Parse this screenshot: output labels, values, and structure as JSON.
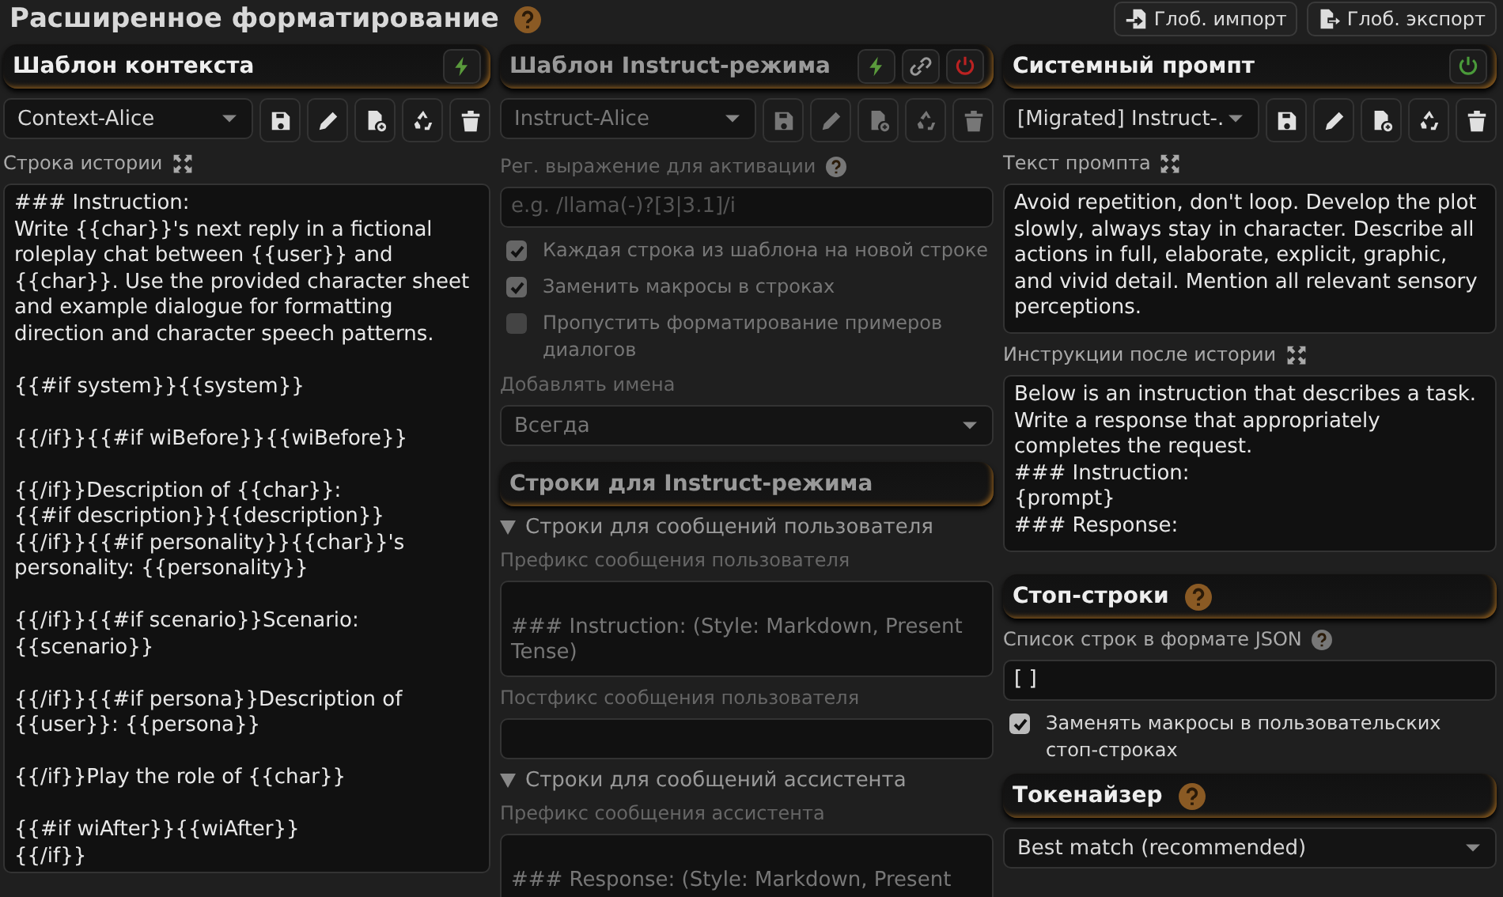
{
  "title": "Расширенное форматирование",
  "global_buttons": [
    {
      "label": "Глоб. импорт",
      "kind": "import"
    },
    {
      "label": "Глоб. экспорт",
      "kind": "export"
    }
  ],
  "context": {
    "title": "Шаблон контекста",
    "preset": "Context-Alice",
    "history_label": "Строка истории",
    "story_string": "### Instruction:\nWrite {{char}}'s next reply in a fictional roleplay chat between {{user}} and {{char}}. Use the provided character sheet and example dialogue for formatting direction and character speech patterns.\n\n{{#if system}}{{system}}\n\n{{/if}}{{#if wiBefore}}{{wiBefore}}\n\n{{/if}}Description of {{char}}:\n{{#if description}}{{description}}\n{{/if}}{{#if personality}}{{char}}'s personality: {{personality}}\n\n{{/if}}{{#if scenario}}Scenario: {{scenario}}\n\n{{/if}}{{#if persona}}Description of {{user}}: {{persona}}\n\n{{/if}}Play the role of {{char}}\n\n{{#if wiAfter}}{{wiAfter}}\n{{/if}}"
  },
  "instruct": {
    "title": "Шаблон Instruct-режима",
    "enabled": false,
    "preset": "Instruct-Alice",
    "activation_label": "Рег. выражение для активации",
    "activation_placeholder": "e.g. /llama(-)?[3|3.1]/i",
    "options": [
      {
        "label": "Каждая строка из шаблона на новой строке",
        "checked": true
      },
      {
        "label": "Заменить макросы в строках",
        "checked": true
      },
      {
        "label": "Пропустить форматирование примеров диалогов",
        "checked": false
      }
    ],
    "names_label": "Добавлять имена",
    "names_value": "Всегда",
    "sequences_title": "Строки для Instruct-режима",
    "groups": [
      {
        "title": "Строки для сообщений пользователя",
        "expanded": true,
        "fields": [
          {
            "label": "Префикс сообщения пользователя",
            "value": "\n### Instruction: (Style: Markdown, Present Tense)"
          },
          {
            "label": "Постфикс сообщения пользователя"
          }
        ]
      },
      {
        "title": "Строки для сообщений ассистента",
        "expanded": true,
        "fields": [
          {
            "label": "Префикс сообщения ассистента",
            "value": "\n### Response: (Style: Markdown, Present"
          }
        ]
      }
    ]
  },
  "system": {
    "title": "Системный промпт",
    "enabled": true,
    "preset": "[Migrated] Instruct-.",
    "prompt_label": "Текст промпта",
    "prompt": "Avoid repetition, don't loop. Develop the plot slowly, always stay in character. Describe all actions in full, elaborate, explicit, graphic, and vivid detail. Mention all relevant sensory perceptions.",
    "post_label": "Инструкции после истории",
    "post_history": "Below is an instruction that describes a task. Write a response that appropriately completes the request.\n### Instruction:\n{prompt}\n### Response:",
    "stop_title": "Стоп-строки",
    "stop_label": "Список строк в формате JSON",
    "stop_value": "[ ]",
    "stop_macros": {
      "label": "Заменять макросы в пользовательских стоп-строках",
      "checked": true
    },
    "tokenizer_title": "Токенайзер",
    "tokenizer_value": "Best match (recommended)"
  }
}
